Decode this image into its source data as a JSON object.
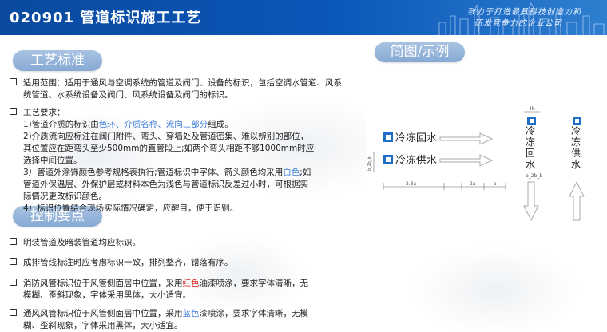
{
  "header": {
    "title": "020901 管道标识施工工艺",
    "slogan_line1": "致力于打造最具科技创造力和",
    "slogan_line2": "研发竞争力的企业公司"
  },
  "sections": {
    "standard_title": "工艺标准",
    "control_title": "控制要点",
    "diagram_title": "简图/示例"
  },
  "scope": {
    "lead": "适用范围：适用于通风与空调系统的管道及阀门、设备的标识，包括空调水管道、风系",
    "cont": "统管道、水系统设备及阀门、风系统设备及阀门的标识。"
  },
  "requirements": {
    "heading": "工艺要求：",
    "r1_pre": "1)管道介质的标识由",
    "r1_color": "色环、",
    "r1_name": "介质名称、",
    "r1_flow": "流向三部分",
    "r1_post": "组成。",
    "r2_a": "2)介质流向应标注在阀门附件、弯头、穿墙处及管道密集、难以辨别的部位，",
    "r2_b": "其位置应在距弯头至少500mm的直管段上;如两个弯头相距不够1000mm时应",
    "r2_c": "选择中间位置。",
    "r3_pre": "3）管道外涂饰颜色参考规格表执行;管道标识中字体、箭头颜色均采用",
    "r3_white": "白色",
    "r3_post": ";如",
    "r3_b": "管道外保温层、外保护层或材料本色为浅色与管道标识反差过小时，可根据实",
    "r3_c": "际情况更改标识颜色。",
    "r4": "4）标识位置结合现场实际情况确定，应醒目，便于识别。"
  },
  "control": {
    "c1": "明装管道及暗装管道均应标识。",
    "c2": "成排管线标注时应考虑标识一致，排列整齐，错落有序。",
    "c3_pre": "消防风管标识位于风管侧面居中位置，采用",
    "c3_color": "红色",
    "c3_post": "油漆喷涂，要求字体清晰，无",
    "c3_b": "模糊、歪斜现象，字体采用黑体，大小适宜。",
    "c4_pre": "通风风管标识位于风管侧面居中位置，采用",
    "c4_color": "蓝色",
    "c4_post": "漆喷涂，要求字体清晰，无模",
    "c4_b": "糊、歪斜现象，字体采用黑体，大小适宜。"
  },
  "diagram": {
    "label_return": "冷冻回水",
    "label_supply": "冷冻供水",
    "dim_4b": "4b",
    "dim_b2b": "b_2b_b",
    "dim_23a": "2.3a",
    "dim_2a": "2a",
    "dim_a": "a",
    "v_return": [
      "冷",
      "冻",
      "回",
      "水"
    ],
    "v_supply": [
      "冷",
      "冻",
      "供",
      "水"
    ]
  },
  "colors": {
    "header": "#0b57b8",
    "pill": "#95b5dc",
    "red": "#e02020",
    "blue": "#3f7fd8",
    "label_blue": "#1f6fc8"
  }
}
